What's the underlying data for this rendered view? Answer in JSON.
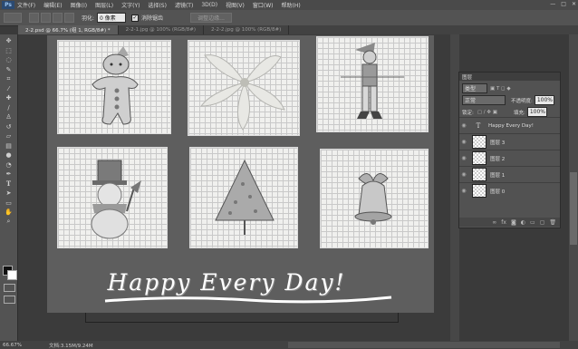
{
  "app": {
    "logo": "Ps"
  },
  "menu": [
    "文件(F)",
    "编辑(E)",
    "图像(I)",
    "图层(L)",
    "文字(Y)",
    "选择(S)",
    "滤镜(T)",
    "3D(D)",
    "视图(V)",
    "窗口(W)",
    "帮助(H)"
  ],
  "window_controls": [
    "—",
    "□",
    "✕"
  ],
  "options": {
    "feather_label": "羽化:",
    "feather_value": "0 像素",
    "antialias_label": "消除锯齿",
    "refine_edge": "调整边缘..."
  },
  "tabs": [
    {
      "label": "2-2.psd @ 66.7% (组 1, RGB/8#) *",
      "active": true
    },
    {
      "label": "2-2-1.jpg @ 100% (RGB/8#)",
      "active": false
    },
    {
      "label": "2-2-2.jpg @ 100% (RGB/8#)",
      "active": false
    }
  ],
  "canvas_text": {
    "headline": "Happy Every Day!"
  },
  "layers_panel": {
    "title": "图层",
    "kind_label": "类型",
    "blend_mode": "正常",
    "opacity_label": "不透明度:",
    "opacity_value": "100%",
    "lock_label": "锁定:",
    "fill_label": "填充:",
    "fill_value": "100%",
    "layers": [
      {
        "name": "Happy Every Day!",
        "type": "text"
      },
      {
        "name": "图层 3",
        "type": "pixel"
      },
      {
        "name": "图层 2",
        "type": "pixel"
      },
      {
        "name": "图层 1",
        "type": "pixel"
      },
      {
        "name": "图层 0",
        "type": "pixel"
      }
    ]
  },
  "status": {
    "zoom": "66.67%",
    "doc": "文档:3.15M/9.24M"
  },
  "tools": [
    "move-icon",
    "marquee-icon",
    "lasso-icon",
    "quick-select-icon",
    "crop-icon",
    "eyedropper-icon",
    "healing-icon",
    "brush-icon",
    "stamp-icon",
    "history-brush-icon",
    "eraser-icon",
    "gradient-icon",
    "blur-icon",
    "dodge-icon",
    "pen-icon",
    "type-icon",
    "path-select-icon",
    "shape-icon",
    "hand-icon",
    "zoom-icon"
  ],
  "colors": {
    "foreground": "#111111",
    "background": "#ffffff"
  }
}
